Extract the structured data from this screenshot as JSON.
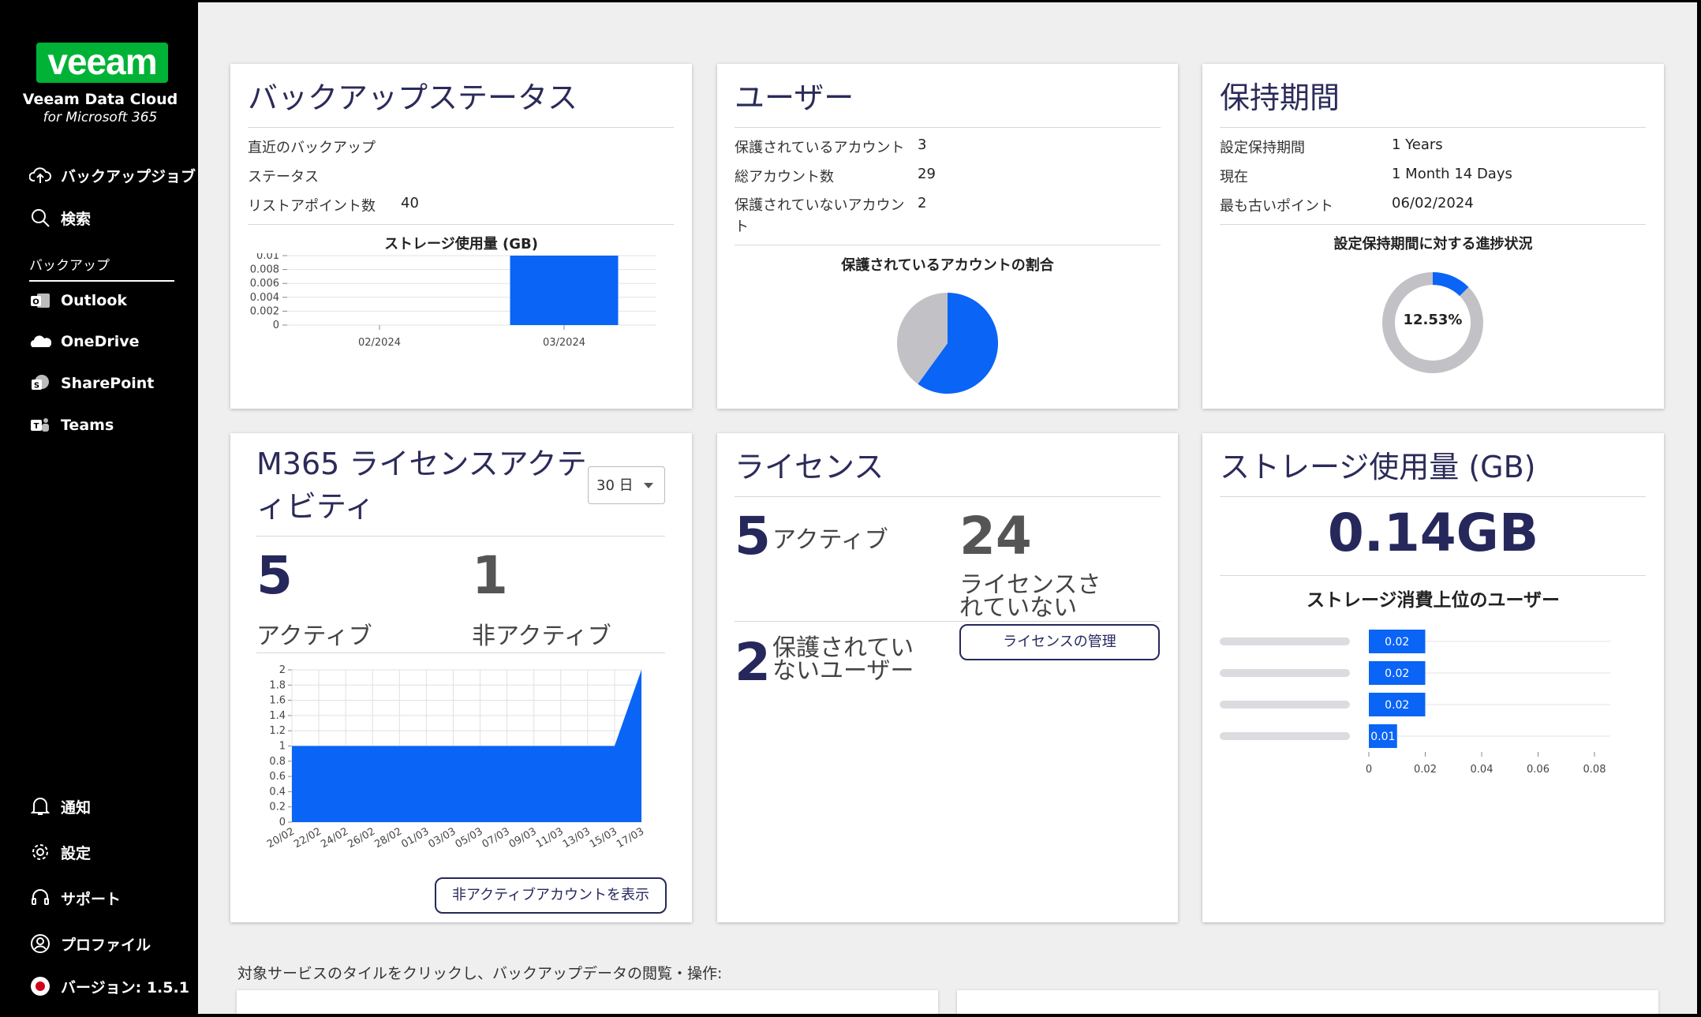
{
  "sidebar": {
    "logo": "veeam",
    "brand_line1": "Veeam Data Cloud",
    "brand_line2": "for Microsoft 365",
    "top_items": [
      {
        "label": "バックアップジョブ",
        "icon": "cloud-upload-icon"
      },
      {
        "label": "検索",
        "icon": "search-icon"
      }
    ],
    "section_label": "バックアップ",
    "backup_items": [
      {
        "label": "Outlook",
        "icon": "outlook-icon"
      },
      {
        "label": "OneDrive",
        "icon": "onedrive-icon"
      },
      {
        "label": "SharePoint",
        "icon": "sharepoint-icon"
      },
      {
        "label": "Teams",
        "icon": "teams-icon"
      }
    ],
    "bottom_items": [
      {
        "label": "通知",
        "icon": "bell-icon"
      },
      {
        "label": "設定",
        "icon": "gear-icon"
      },
      {
        "label": "サポート",
        "icon": "headset-icon"
      },
      {
        "label": "プロファイル",
        "icon": "user-icon"
      },
      {
        "label": "バージョン: 1.5.1",
        "icon": "flag-japan-icon"
      }
    ]
  },
  "backup_status": {
    "title": "バックアップステータス",
    "rows": [
      {
        "label": "直近のバックアップ",
        "value": ""
      },
      {
        "label": "ステータス",
        "value": ""
      },
      {
        "label": "リストアポイント数",
        "value": "40"
      }
    ],
    "chart_title": "ストレージ使用量 (GB)"
  },
  "users": {
    "title": "ユーザー",
    "rows": [
      {
        "label": "保護されているアカウント",
        "value": "3"
      },
      {
        "label": "総アカウント数",
        "value": "29"
      },
      {
        "label": "保護されていないアカウン\nト",
        "value": "2"
      }
    ],
    "chart_title": "保護されているアカウントの割合"
  },
  "retention": {
    "title": "保持期間",
    "rows": [
      {
        "label": "設定保持期間",
        "value": "1 Years"
      },
      {
        "label": "現在",
        "value": "1 Month 14 Days"
      },
      {
        "label": "最も古いポイント",
        "value": "06/02/2024"
      }
    ],
    "chart_title": "設定保持期間に対する進捗状況",
    "progress_label": "12.53%",
    "progress_value": 12.53
  },
  "license_activity": {
    "title_line1": "M365 ライセンスアクテ",
    "title_line2": "ィビティ",
    "period_select": "30 日",
    "active_count": "5",
    "active_label": "アクティブ",
    "inactive_count": "1",
    "inactive_label": "非アクティブ",
    "button": "非アクティブアカウントを表示"
  },
  "license": {
    "title": "ライセンス",
    "active_count": "5",
    "active_label": "アクティブ",
    "unlicensed_count": "24",
    "unlicensed_label_line1": "ライセンスさ",
    "unlicensed_label_line2": "れていない",
    "unprotected_count": "2",
    "unprotected_label_line1": "保護されてい",
    "unprotected_label_line2": "ないユーザー",
    "button": "ライセンスの管理"
  },
  "storage": {
    "title": "ストレージ使用量 (GB)",
    "total": "0.14GB",
    "chart_title": "ストレージ消費上位のユーザー"
  },
  "footer": {
    "hint": "対象サービスのタイルをクリックし、バックアップデータの閲覧・操作:"
  },
  "colors": {
    "accent_blue": "#0a64f5",
    "veeam_green": "#00b336",
    "navy_text": "#26285c",
    "grey_slice": "#c2c2c6"
  },
  "chart_data": [
    {
      "type": "bar",
      "title": "ストレージ使用量 (GB)",
      "categories": [
        "02/2024",
        "03/2024"
      ],
      "values": [
        0,
        0.01
      ],
      "ylim": [
        0,
        0.01
      ],
      "yticks": [
        "0.01",
        "0.008",
        "0.006",
        "0.004",
        "0.002",
        "0"
      ]
    },
    {
      "type": "pie",
      "title": "保護されているアカウントの割合",
      "values": [
        3,
        2
      ],
      "colors": [
        "#0a64f5",
        "#c2c2c6"
      ]
    },
    {
      "type": "pie",
      "title": "設定保持期間に対する進捗状況",
      "values": [
        12.53,
        87.47
      ],
      "colors": [
        "#0a64f5",
        "#c2c2c6"
      ]
    },
    {
      "type": "area",
      "categories": [
        "20/02",
        "22/02",
        "24/02",
        "26/02",
        "28/02",
        "01/03",
        "03/03",
        "05/03",
        "07/03",
        "09/03",
        "11/03",
        "13/03",
        "15/03",
        "17/03"
      ],
      "values": [
        1,
        1,
        1,
        1,
        1,
        1,
        1,
        1,
        1,
        1,
        1,
        1,
        1,
        2
      ],
      "ylim": [
        0,
        2
      ],
      "yticks": [
        "2",
        "1.8",
        "1.6",
        "1.4",
        "1.2",
        "1",
        "0.8",
        "0.6",
        "0.4",
        "0.2",
        "0"
      ]
    },
    {
      "type": "bar",
      "orientation": "horizontal",
      "title": "ストレージ消費上位のユーザー",
      "values": [
        0.02,
        0.02,
        0.02,
        0.01
      ],
      "value_labels": [
        "0.02",
        "0.02",
        "0.02",
        "0.01"
      ],
      "xlim": [
        0,
        0.08
      ],
      "xticks": [
        "0",
        "0.02",
        "0.04",
        "0.06",
        "0.08"
      ]
    }
  ]
}
